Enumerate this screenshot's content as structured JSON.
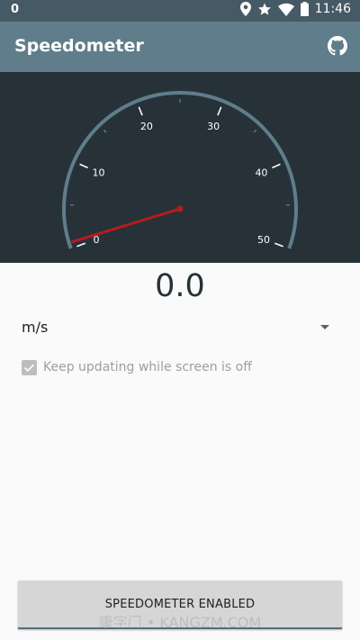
{
  "status_bar": {
    "notification_count": "0",
    "time": "11:46",
    "icons": [
      "location-icon",
      "star-icon",
      "wifi-icon",
      "battery-icon"
    ]
  },
  "app_bar": {
    "title": "Speedometer",
    "action_icon": "github-icon"
  },
  "gauge": {
    "tick_labels": [
      "0",
      "10",
      "20",
      "30",
      "40",
      "50"
    ],
    "needle_value": 0,
    "min": 0,
    "max": 50,
    "colors": {
      "background": "#263238",
      "arc": "#607d8b",
      "needle": "#b71c1c"
    }
  },
  "speed": {
    "value": "0.0"
  },
  "unit": {
    "selected": "m/s"
  },
  "keep_updating": {
    "label": "Keep updating while screen is off",
    "checked": true
  },
  "button": {
    "label": "SPEEDOMETER ENABLED"
  },
  "watermark": {
    "text": "康字门 • KANGZM.COM"
  }
}
